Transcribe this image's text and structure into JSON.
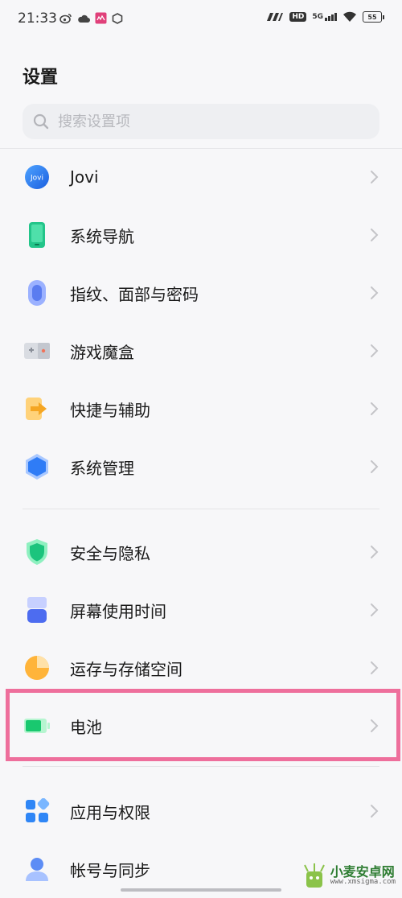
{
  "status_bar": {
    "time": "21:33",
    "network": "5G",
    "hd": "HD",
    "battery": "55"
  },
  "page": {
    "title": "设置"
  },
  "search": {
    "placeholder": "搜索设置项"
  },
  "groups": [
    {
      "items": [
        {
          "label": "Jovi",
          "icon": "jovi-icon",
          "icon_text": "Jovi"
        },
        {
          "label": "系统导航",
          "icon": "phone-icon"
        },
        {
          "label": "指纹、面部与密码",
          "icon": "fingerprint-icon"
        },
        {
          "label": "游戏魔盒",
          "icon": "gamepad-icon"
        },
        {
          "label": "快捷与辅助",
          "icon": "shortcut-arrow-icon"
        },
        {
          "label": "系统管理",
          "icon": "hexagon-icon"
        }
      ]
    },
    {
      "items": [
        {
          "label": "安全与隐私",
          "icon": "shield-icon"
        },
        {
          "label": "屏幕使用时间",
          "icon": "hourglass-icon"
        },
        {
          "label": "运存与存储空间",
          "icon": "pie-chart-icon"
        },
        {
          "label": "电池",
          "icon": "battery-icon",
          "highlighted": true
        }
      ]
    },
    {
      "items": [
        {
          "label": "应用与权限",
          "icon": "apps-grid-icon"
        },
        {
          "label": "帐号与同步",
          "icon": "account-icon"
        }
      ]
    }
  ],
  "watermark": {
    "title": "小麦安卓网",
    "url": "www.xmsigma.com"
  },
  "colors": {
    "highlight": "#ee6f9c",
    "accent": "#3d7bf5"
  }
}
